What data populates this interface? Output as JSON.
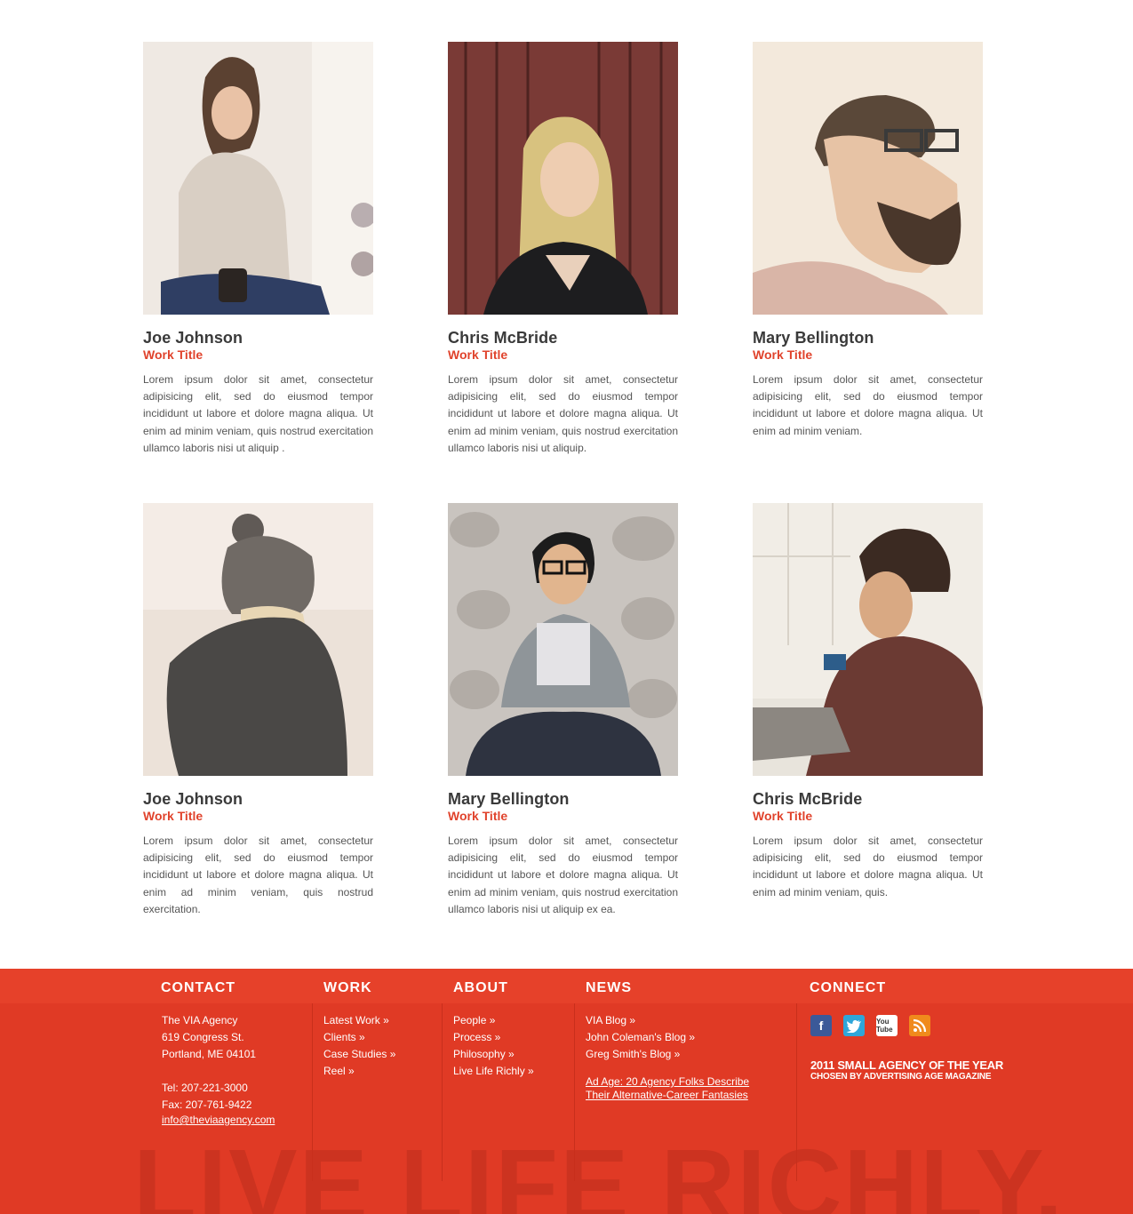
{
  "team": [
    {
      "name": "Joe Johnson",
      "role": "Work Title",
      "bio": "Lorem ipsum dolor sit amet, consectetur adipisicing elit, sed do eiusmod tempor incididunt ut labore et dolore magna aliqua. Ut enim ad minim veniam, quis nostrud exercitation ullamco laboris nisi ut aliquip ."
    },
    {
      "name": "Chris McBride",
      "role": "Work Title",
      "bio": "Lorem ipsum dolor sit amet, consectetur adipisicing elit, sed do eiusmod tempor incididunt ut labore et dolore magna aliqua. Ut enim ad minim veniam, quis nostrud exercitation ullamco laboris nisi ut aliquip."
    },
    {
      "name": "Mary Bellington",
      "role": "Work Title",
      "bio": "Lorem ipsum dolor sit amet, consectetur adipisicing elit, sed do eiusmod tempor incididunt ut labore et dolore magna aliqua. Ut enim ad minim veniam."
    },
    {
      "name": "Joe Johnson",
      "role": "Work Title",
      "bio": "Lorem ipsum dolor sit amet, consectetur adipisicing elit, sed do eiusmod tempor incididunt ut labore et dolore magna aliqua. Ut enim ad minim veniam, quis nostrud exercitation."
    },
    {
      "name": "Mary Bellington",
      "role": "Work Title",
      "bio": "Lorem ipsum dolor sit amet, consectetur adipisicing elit, sed do eiusmod tempor incididunt ut labore et dolore magna aliqua. Ut enim ad minim veniam, quis nostrud exercitation ullamco laboris nisi ut aliquip ex ea."
    },
    {
      "name": "Chris McBride",
      "role": "Work Title",
      "bio": "Lorem ipsum dolor sit amet, consectetur adipisicing elit, sed do eiusmod tempor incididunt ut labore et dolore magna aliqua. Ut enim ad minim veniam, quis."
    }
  ],
  "footer": {
    "contact": {
      "heading": "CONTACT",
      "lines": [
        "The VIA Agency",
        "619 Congress St.",
        "Portland, ME 04101"
      ],
      "tel": "Tel: 207-221-3000",
      "fax": "Fax: 207-761-9422",
      "email": "info@theviaagency.com"
    },
    "work": {
      "heading": "WORK",
      "links": [
        "Latest Work »",
        "Clients »",
        "Case Studies »",
        "Reel »"
      ]
    },
    "about": {
      "heading": "ABOUT",
      "links": [
        "People »",
        "Process »",
        "Philosophy »",
        "Live Life Richly »"
      ]
    },
    "news": {
      "heading": "NEWS",
      "links": [
        "VIA Blog »",
        "John Coleman's Blog »",
        "Greg Smith's Blog »"
      ],
      "article_line1": "Ad Age: 20 Agency Folks Describe ",
      "article_line2": "Their Alternative-Career Fantasies"
    },
    "connect": {
      "heading": "CONNECT",
      "social_icons": [
        "facebook-icon",
        "twitter-icon",
        "youtube-icon",
        "rss-icon"
      ],
      "youtube_text": "You Tube",
      "award_line1": "2011 SMALL AGENCY OF THE YEAR",
      "award_line2": "CHOSEN BY ADVERTISING AGE MAGAZINE"
    },
    "tagline": "LIVE LIFE RICHLY."
  },
  "colors": {
    "accent": "#e0432c",
    "footer_bg": "#e03a25",
    "footer_header": "#e6412a"
  }
}
